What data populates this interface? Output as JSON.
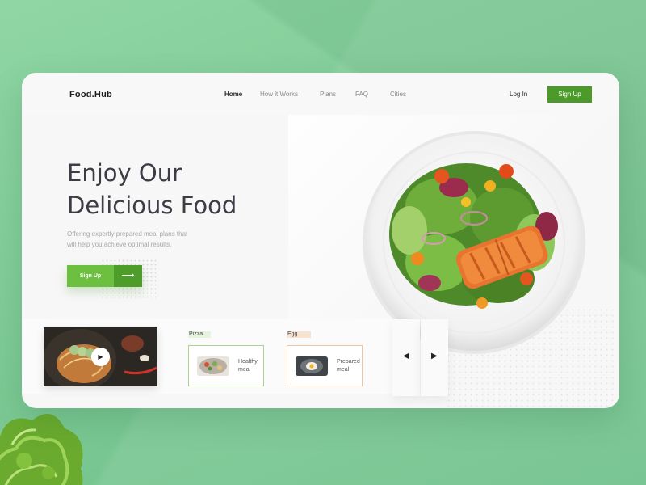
{
  "brand": {
    "logo": "Food.Hub"
  },
  "nav": {
    "items": [
      "Home",
      "How it Works",
      "Plans",
      "FAQ",
      "Cities"
    ],
    "login": "Log In",
    "signup": "Sign Up"
  },
  "hero": {
    "title_line1": "Enjoy Our",
    "title_line2": "Delicious Food",
    "subtitle_line1": "Offering expertly prepared meal plans that",
    "subtitle_line2": "will help you achieve optimal results.",
    "cta_label": "Sign Up",
    "cta_icon": "arrow-right-icon"
  },
  "video": {
    "play_icon": "play-icon"
  },
  "categories": [
    {
      "tag": "Pizza",
      "label_line1": "Healthy",
      "label_line2": "meal",
      "tag_color": "#e6f3dd",
      "border_color": "#a8d48f"
    },
    {
      "tag": "Egg",
      "label_line1": "Prepared",
      "label_line2": "meal",
      "tag_color": "#f7e3d1",
      "border_color": "#f0c39a"
    }
  ],
  "carousel": {
    "prev_icon": "caret-left-icon",
    "next_icon": "caret-right-icon"
  },
  "colors": {
    "primary": "#4c9a2a",
    "cta": "#6cbf3f",
    "background": "#86d19d"
  }
}
